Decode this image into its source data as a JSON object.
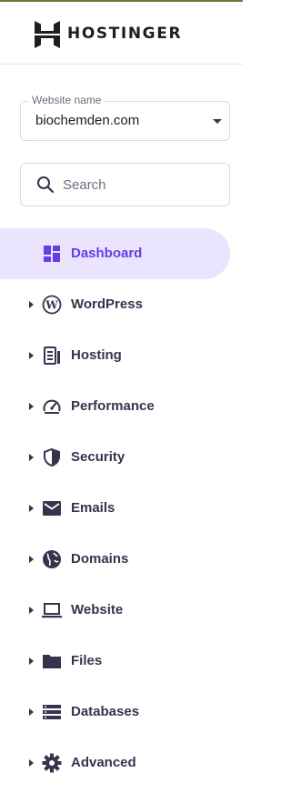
{
  "brand": {
    "name": "HOSTINGER"
  },
  "website_select": {
    "label": "Website name",
    "value": "biochemden.com"
  },
  "search": {
    "placeholder": "Search",
    "value": ""
  },
  "colors": {
    "accent": "#673de6",
    "active_bg": "#ebe4ff",
    "icon": "#36344d"
  },
  "nav": [
    {
      "label": "Dashboard",
      "icon": "dashboard-icon",
      "active": true,
      "expandable": false
    },
    {
      "label": "WordPress",
      "icon": "wordpress-icon",
      "active": false,
      "expandable": true
    },
    {
      "label": "Hosting",
      "icon": "hosting-icon",
      "active": false,
      "expandable": true
    },
    {
      "label": "Performance",
      "icon": "speedometer-icon",
      "active": false,
      "expandable": true
    },
    {
      "label": "Security",
      "icon": "shield-icon",
      "active": false,
      "expandable": true
    },
    {
      "label": "Emails",
      "icon": "envelope-icon",
      "active": false,
      "expandable": true
    },
    {
      "label": "Domains",
      "icon": "globe-icon",
      "active": false,
      "expandable": true
    },
    {
      "label": "Website",
      "icon": "laptop-icon",
      "active": false,
      "expandable": true
    },
    {
      "label": "Files",
      "icon": "folder-icon",
      "active": false,
      "expandable": true
    },
    {
      "label": "Databases",
      "icon": "database-icon",
      "active": false,
      "expandable": true
    },
    {
      "label": "Advanced",
      "icon": "gear-icon",
      "active": false,
      "expandable": true
    }
  ]
}
